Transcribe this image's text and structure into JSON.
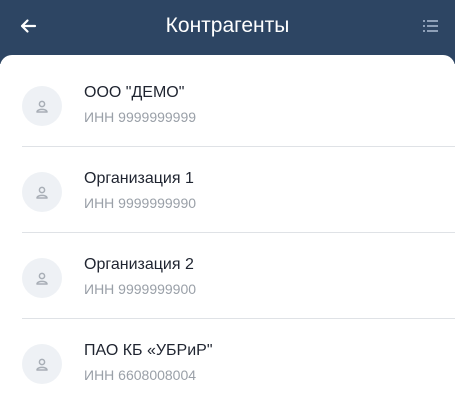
{
  "header": {
    "title": "Контрагенты",
    "back_icon": "arrow-left-icon",
    "menu_icon": "list-menu-icon",
    "background": "#2d4563"
  },
  "contractors": [
    {
      "name": "ООО \"ДЕМО\"",
      "inn": "ИНН 9999999999"
    },
    {
      "name": "Организация 1",
      "inn": "ИНН 9999999990"
    },
    {
      "name": "Организация 2",
      "inn": "ИНН 9999999900"
    },
    {
      "name": "ПАО КБ «УБРиР\"",
      "inn": "ИНН 6608008004"
    }
  ]
}
